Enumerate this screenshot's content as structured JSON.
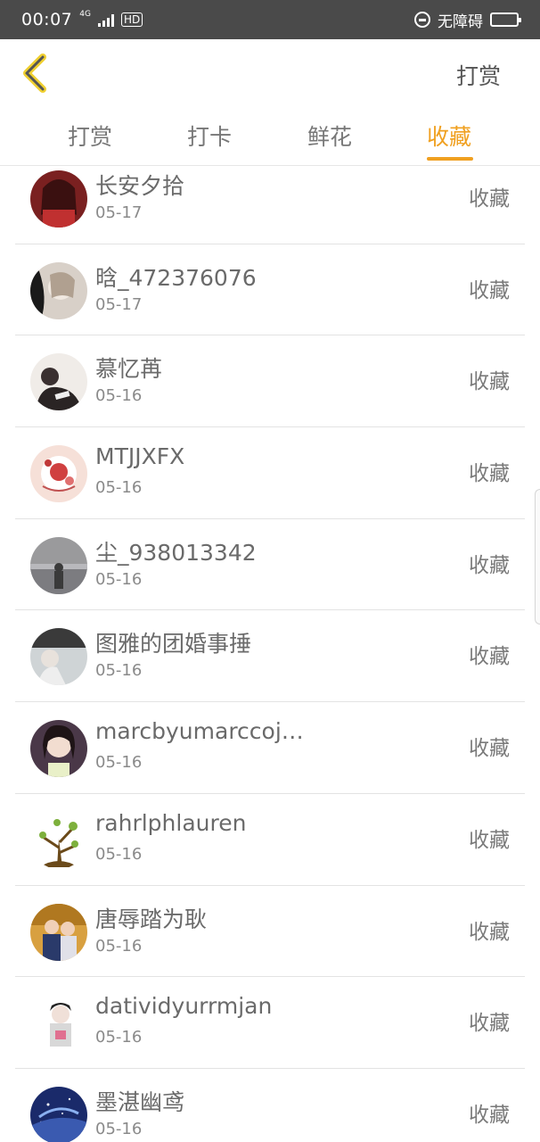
{
  "status_bar": {
    "time": "00:07",
    "network": "4G",
    "hd": "HD",
    "accessibility_label": "无障碍",
    "battery_level": 0.2
  },
  "header": {
    "back_icon": "chevron-left-icon",
    "action_label": "打赏",
    "accent_color": "#f0a020"
  },
  "tabs": [
    {
      "label": "打赏",
      "active": false
    },
    {
      "label": "打卡",
      "active": false
    },
    {
      "label": "鲜花",
      "active": false
    },
    {
      "label": "收藏",
      "active": true
    }
  ],
  "list": {
    "items": [
      {
        "name": "长安夕拾",
        "date": "05-17",
        "action": "收藏"
      },
      {
        "name": "晗_472376076",
        "date": "05-17",
        "action": "收藏"
      },
      {
        "name": "慕忆苒",
        "date": "05-16",
        "action": "收藏"
      },
      {
        "name": "MTJJXFX",
        "date": "05-16",
        "action": "收藏"
      },
      {
        "name": "尘_938013342",
        "date": "05-16",
        "action": "收藏"
      },
      {
        "name": "图雅的团婚事捶",
        "date": "05-16",
        "action": "收藏"
      },
      {
        "name": "marcbyumarccoja…",
        "date": "05-16",
        "action": "收藏"
      },
      {
        "name": "rahrlphlauren",
        "date": "05-16",
        "action": "收藏"
      },
      {
        "name": "唐辱踏为耿",
        "date": "05-16",
        "action": "收藏"
      },
      {
        "name": "datividyurrmjan",
        "date": "05-16",
        "action": "收藏"
      },
      {
        "name": "墨湛幽鸢",
        "date": "05-16",
        "action": "收藏"
      }
    ]
  }
}
